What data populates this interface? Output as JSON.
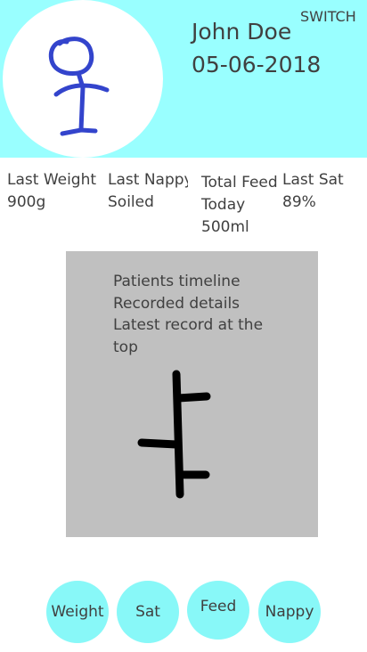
{
  "header": {
    "patient_name": "John Doe",
    "date": "05-06-2018",
    "switch_label": "SWITCH"
  },
  "stats": {
    "weight": {
      "label": "Last Weight",
      "value": "900g"
    },
    "nappy": {
      "label": "Last Nappy",
      "value": "Soiled"
    },
    "feed": {
      "label_line1": "Total Feed",
      "label_line2": "Today",
      "value": "500ml"
    },
    "sat": {
      "label": "Last Sat",
      "value": "89%"
    }
  },
  "timeline": {
    "line1": "Patients timeline",
    "line2": "Recorded details",
    "line3": "Latest record at the top"
  },
  "buttons": {
    "weight": "Weight",
    "sat": "Sat",
    "feed": "Feed",
    "nappy": "Nappy"
  },
  "colors": {
    "header_bg": "#99ffff",
    "button_bg": "#88f8f8",
    "timeline_bg": "#c0c0c0",
    "avatar_stroke": "#3344cc"
  }
}
